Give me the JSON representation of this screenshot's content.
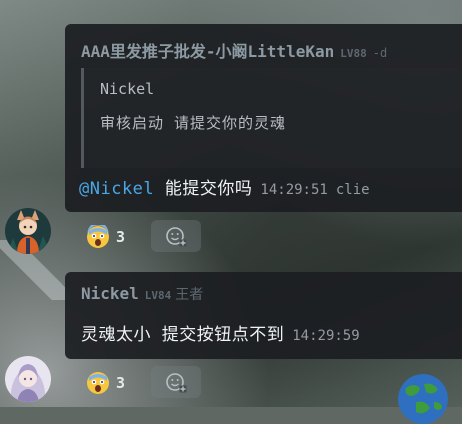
{
  "message1": {
    "sender_name": "AAA里发推子批发-小阚LittleKan",
    "sender_level": "LV88",
    "sender_tail": "-d",
    "quote": {
      "name": "Nickel",
      "text": "审核启动 请提交你的灵魂"
    },
    "mention": "@Nickel",
    "text": "能提交你吗",
    "time": "14:29:51",
    "client": "clie",
    "reaction": {
      "emoji": "screaming-face-icon",
      "count": "3"
    }
  },
  "message2": {
    "sender_name": "Nickel",
    "sender_level": "LV84",
    "sender_title": "王者",
    "text": "灵魂太小 提交按钮点不到",
    "time": "14:29:59",
    "reaction": {
      "emoji": "screaming-face-icon",
      "count": "3"
    }
  },
  "colors": {
    "bubble": "#1c1e21",
    "mention": "#4aa7e6",
    "text": "#f0f2f3",
    "muted": "#949ca3"
  }
}
